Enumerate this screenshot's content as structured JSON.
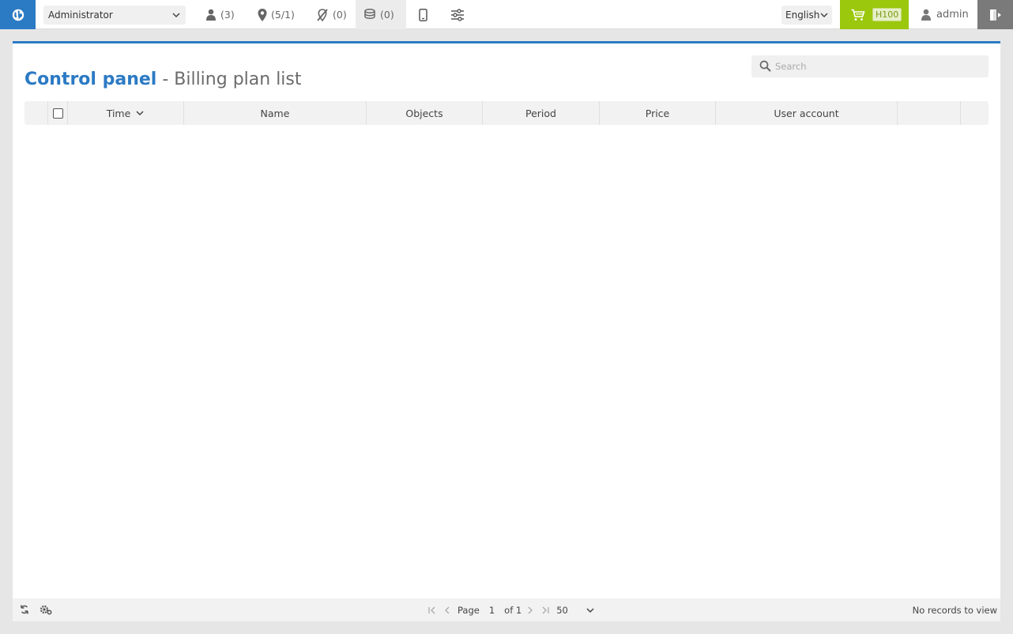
{
  "topbar": {
    "role_select": "Administrator",
    "users_count": "(3)",
    "objects_count": "(5/1)",
    "events_count": "(0)",
    "billing_count": "(0)",
    "language": "English",
    "cart_badge": "H100",
    "username": "admin"
  },
  "page": {
    "title_strong": "Control panel",
    "title_rest": " - Billing plan list",
    "search_placeholder": "Search"
  },
  "table": {
    "columns": [
      "Time",
      "Name",
      "Objects",
      "Period",
      "Price",
      "User account"
    ]
  },
  "footer": {
    "page_label": "Page",
    "page_value": "1",
    "of_label": "of 1",
    "per_page": "50",
    "status": "No records to view"
  },
  "colors": {
    "accent": "#2b7ac4",
    "cart": "#9bc70d",
    "logout": "#7a7a7a"
  }
}
